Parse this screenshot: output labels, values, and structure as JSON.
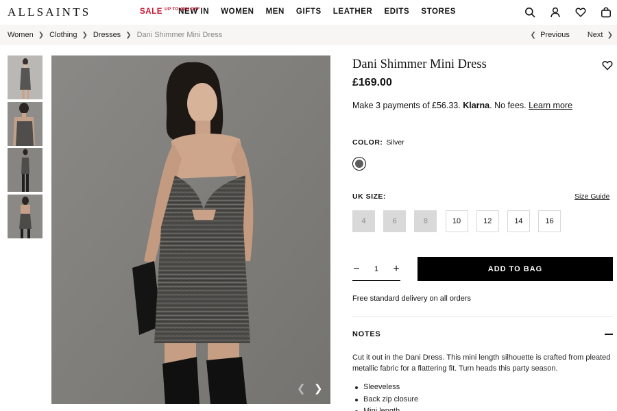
{
  "header": {
    "logo": "ALLSAINTS",
    "nav": [
      {
        "label": "SALE",
        "badge": "UP TO 40% OFF",
        "color": "#c8102e"
      },
      {
        "label": "NEW IN"
      },
      {
        "label": "WOMEN"
      },
      {
        "label": "MEN"
      },
      {
        "label": "GIFTS"
      },
      {
        "label": "LEATHER"
      },
      {
        "label": "EDITS"
      },
      {
        "label": "STORES"
      }
    ],
    "icons": [
      "search-icon",
      "account-icon",
      "wishlist-icon",
      "bag-icon"
    ]
  },
  "breadcrumb": {
    "items": [
      "Women",
      "Clothing",
      "Dresses",
      "Dani Shimmer Mini Dress"
    ],
    "previous_label": "Previous",
    "next_label": "Next"
  },
  "gallery": {
    "thumbnail_count": 4,
    "selected_index": 0
  },
  "product": {
    "title": "Dani Shimmer Mini Dress",
    "price": "£169.00",
    "klarna": {
      "prefix": "Make 3 payments of £56.33.",
      "brand": "Klarna",
      "suffix": ". No fees.",
      "link": "Learn more"
    },
    "color": {
      "label": "COLOR:",
      "value": "Silver",
      "swatch_color": "#5d5d5d"
    },
    "size": {
      "label": "UK SIZE:",
      "guide_label": "Size Guide",
      "options": [
        {
          "label": "4",
          "available": false
        },
        {
          "label": "6",
          "available": false
        },
        {
          "label": "8",
          "available": false
        },
        {
          "label": "10",
          "available": true
        },
        {
          "label": "12",
          "available": true
        },
        {
          "label": "14",
          "available": true
        },
        {
          "label": "16",
          "available": true
        }
      ]
    },
    "quantity": {
      "value": "1",
      "decrement": "−",
      "increment": "+"
    },
    "add_to_bag_label": "ADD TO BAG",
    "delivery": "Free standard delivery on all orders",
    "notes": {
      "heading": "NOTES",
      "description": "Cut it out in the Dani Dress. This mini length silhouette is crafted from pleated metallic fabric for a flattering fit. Turn heads this party season.",
      "bullets": [
        "Sleeveless",
        "Back zip closure",
        "Mini length"
      ]
    }
  }
}
